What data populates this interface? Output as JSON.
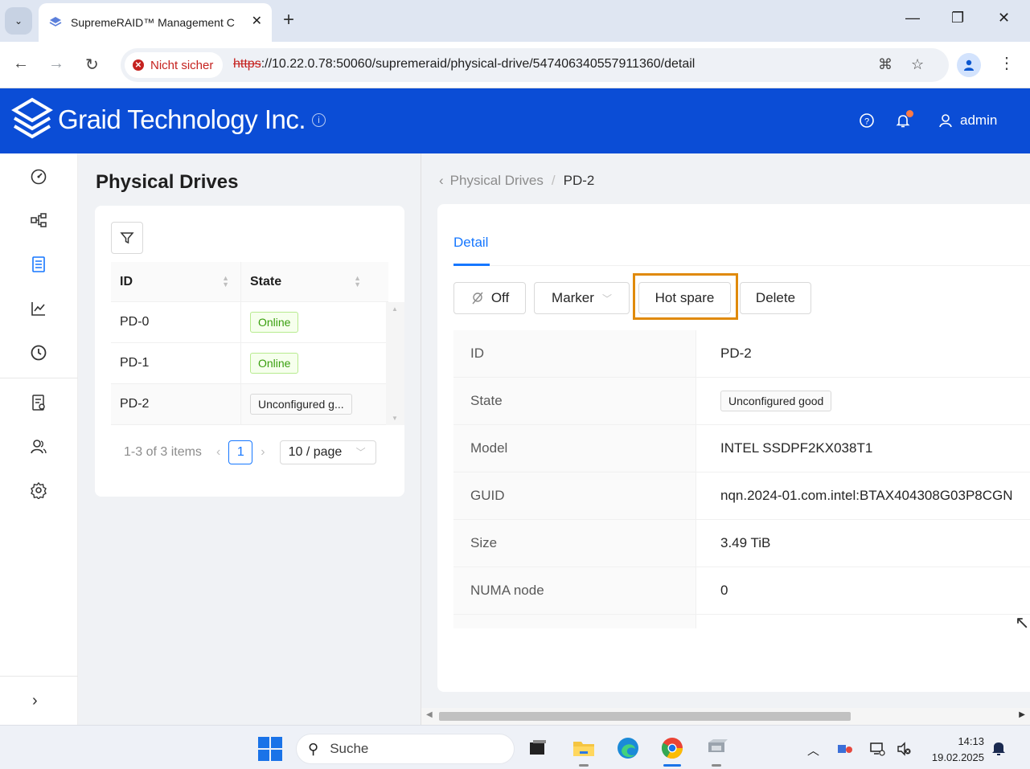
{
  "browser": {
    "tab_title": "SupremeRAID™ Management C",
    "insecure_label": "Nicht sicher",
    "url_scheme": "https",
    "url_rest": "://10.22.0.78:50060/supremeraid/physical-drive/547406340557911360/detail"
  },
  "header": {
    "brand": "Graid Technology Inc.",
    "user": "admin"
  },
  "list": {
    "title": "Physical Drives",
    "columns": [
      "ID",
      "State"
    ],
    "rows": [
      {
        "id": "PD-0",
        "state": "Online"
      },
      {
        "id": "PD-1",
        "state": "Online"
      },
      {
        "id": "PD-2",
        "state": "Unconfigured g..."
      }
    ],
    "pagination": {
      "total": "1-3 of 3 items",
      "current": "1",
      "page_size": "10 / page"
    }
  },
  "detail": {
    "breadcrumb_parent": "Physical Drives",
    "breadcrumb_current": "PD-2",
    "tab": "Detail",
    "actions": {
      "off": "Off",
      "marker": "Marker",
      "hot_spare": "Hot spare",
      "delete": "Delete"
    },
    "fields": [
      {
        "label": "ID",
        "value": "PD-2"
      },
      {
        "label": "State",
        "value": "Unconfigured good"
      },
      {
        "label": "Model",
        "value": "INTEL SSDPF2KX038T1"
      },
      {
        "label": "GUID",
        "value": "nqn.2024-01.com.intel:BTAX404308G03P8CGN"
      },
      {
        "label": "Size",
        "value": "3.49 TiB"
      },
      {
        "label": "NUMA node",
        "value": "0"
      }
    ]
  },
  "taskbar": {
    "search_placeholder": "Suche",
    "time": "14:13",
    "date": "19.02.2025"
  },
  "colors": {
    "header_bg": "#0b4dd6",
    "primary": "#1677ff",
    "highlight": "#e08a0b",
    "online_tag": "#389e0d"
  }
}
